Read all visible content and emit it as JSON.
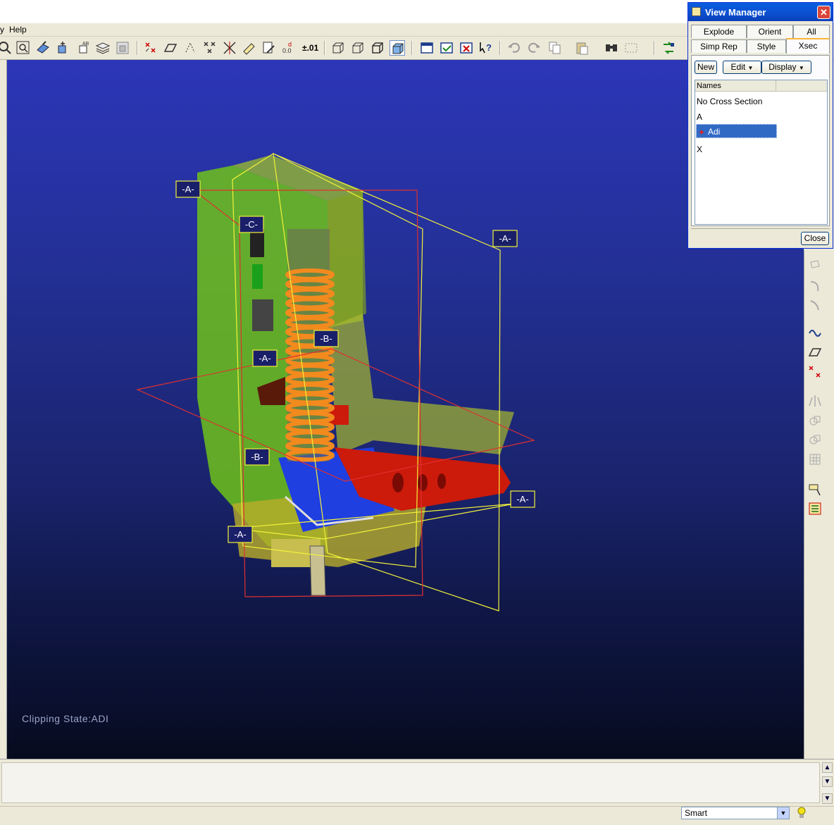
{
  "menu": {
    "items": [
      {
        "label": "y"
      },
      {
        "label": "Help"
      }
    ]
  },
  "toolbar": {
    "icons": [
      "zoom-out-icon",
      "zoom-window-icon",
      "pan-icon",
      "spin-center-icon",
      "view-names-icon",
      "layers-icon",
      "model-tree-icon",
      "datum-planes-icon",
      "datum-axes-icon",
      "datum-points-icon",
      "coordinate-systems-icon",
      "annotations-icon",
      "notes-icon",
      "dimensions-icon",
      "tolerance-value-icon",
      "wireframe-icon",
      "hidden-line-icon",
      "no-hidden-icon",
      "shading-icon",
      "window-open-icon",
      "window-activate-icon",
      "window-close-icon",
      "context-help-icon",
      "undo-icon",
      "redo-icon",
      "copy-icon",
      "paste-icon",
      "find-icon",
      "select-box-icon",
      "regenerate-icon"
    ],
    "tolerance_label": "±.01"
  },
  "viewport": {
    "clipping_state": "Clipping State:ADI",
    "datum_tags": [
      "-A-",
      "-A-",
      "-C-",
      "-B-",
      "-A-",
      "-B-",
      "-A-",
      "-A-"
    ],
    "colors": {
      "bg_top": "#2c36b8",
      "bg_bottom": "#070b1f",
      "housing": "#6fc21a",
      "spring": "#f28a1e",
      "cam": "#cc1a0b",
      "actuator": "#1f3fe0",
      "tag_border": "#f2f23a",
      "plane_red": "#e03030",
      "plane_yellow": "#f2f23a"
    }
  },
  "view_manager": {
    "title": "View Manager",
    "tabs_row1": [
      "Explode",
      "Orient",
      "All"
    ],
    "tabs_row2": [
      "Simp Rep",
      "Style",
      "Xsec"
    ],
    "selected_tab": "Xsec",
    "buttons": {
      "new": "New",
      "edit": "Edit",
      "display": "Display"
    },
    "list_header": "Names",
    "items": [
      "No Cross Section",
      "A",
      "Adi",
      "X"
    ],
    "selected_item": "Adi",
    "close_label": "Close"
  },
  "status": {
    "filter_value": "Smart"
  }
}
